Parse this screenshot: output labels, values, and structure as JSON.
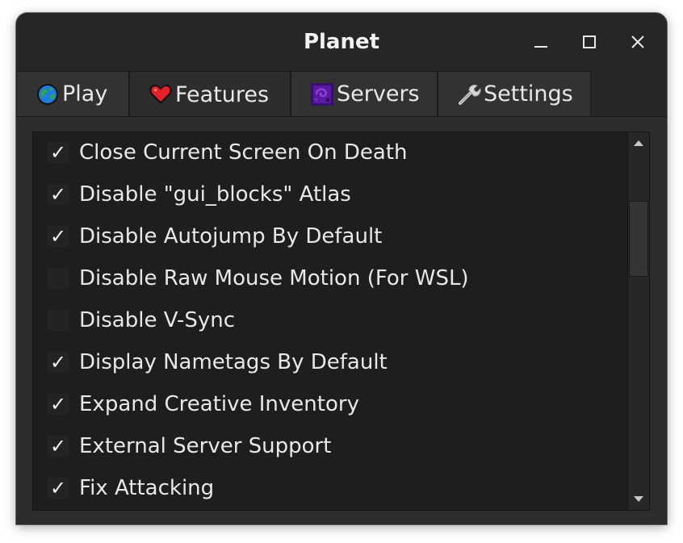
{
  "window": {
    "title": "Planet",
    "controls": {
      "minimize_icon": "minimize-icon",
      "maximize_icon": "maximize-icon",
      "close_icon": "close-icon"
    }
  },
  "tabs": [
    {
      "label": "Play",
      "icon": "globe-icon",
      "active": false
    },
    {
      "label": "Features",
      "icon": "heart-icon",
      "active": true
    },
    {
      "label": "Servers",
      "icon": "portal-icon",
      "active": false
    },
    {
      "label": "Settings",
      "icon": "wrench-icon",
      "active": false
    }
  ],
  "features": [
    {
      "label": "Close Current Screen On Death",
      "checked": true
    },
    {
      "label": "Disable \"gui_blocks\" Atlas",
      "checked": true
    },
    {
      "label": "Disable Autojump By Default",
      "checked": true
    },
    {
      "label": "Disable Raw Mouse Motion (For WSL)",
      "checked": false
    },
    {
      "label": "Disable V-Sync",
      "checked": false
    },
    {
      "label": "Display Nametags By Default",
      "checked": true
    },
    {
      "label": "Expand Creative Inventory",
      "checked": true
    },
    {
      "label": "External Server Support",
      "checked": true
    },
    {
      "label": "Fix Attacking",
      "checked": true
    }
  ],
  "check_glyph": "✓",
  "colors": {
    "window_bg": "#2a2a2b",
    "list_bg": "#1d1e1f",
    "text": "#e8e8e8",
    "heart": "#e8202a",
    "globe": "#1e7be0",
    "portal": "#5a1aa0"
  }
}
